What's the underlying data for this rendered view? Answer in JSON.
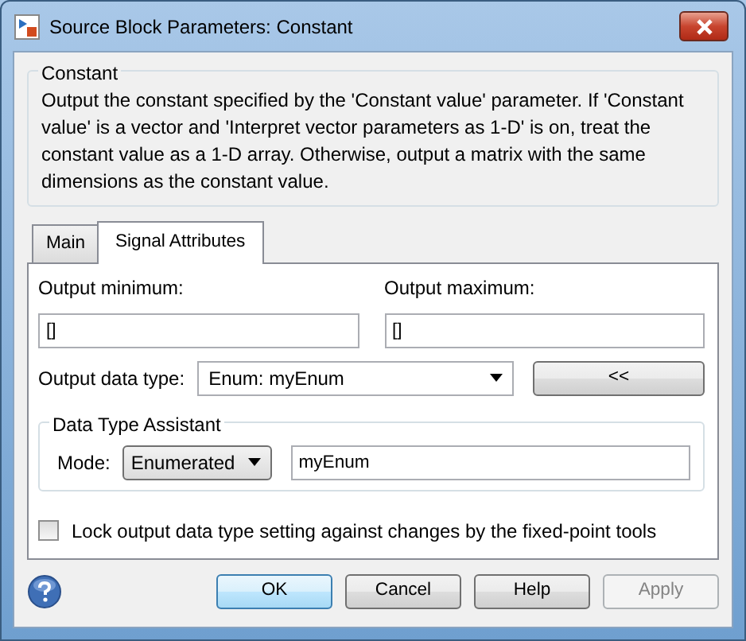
{
  "window": {
    "title": "Source Block Parameters: Constant"
  },
  "block": {
    "name": "Constant",
    "description": "Output the constant specified by the 'Constant value' parameter. If 'Constant value' is a vector and 'Interpret vector parameters as 1-D' is on, treat the constant value as a 1-D array. Otherwise, output a matrix with the same dimensions as the constant value."
  },
  "tabs": [
    {
      "label": "Main",
      "selected": false
    },
    {
      "label": "Signal Attributes",
      "selected": true
    }
  ],
  "range_fields": [
    {
      "label": "Output minimum:",
      "value": "[]"
    },
    {
      "label": "Output maximum:",
      "value": "[]"
    }
  ],
  "data_type": {
    "label": "Output data type:",
    "value": "Enum: myEnum",
    "button": "<<"
  },
  "assistant": {
    "title": "Data Type Assistant",
    "mode_label": "Mode:",
    "mode": "Enumerated",
    "value": "myEnum"
  },
  "lock": {
    "label": "Lock output data type setting against changes by the fixed-point tools",
    "checked": false
  },
  "buttons": [
    {
      "label": "OK",
      "kind": "default",
      "disabled": false
    },
    {
      "label": "Cancel",
      "kind": "normal",
      "disabled": false
    },
    {
      "label": "Help",
      "kind": "normal",
      "disabled": false
    },
    {
      "label": "Apply",
      "kind": "normal",
      "disabled": true
    }
  ]
}
